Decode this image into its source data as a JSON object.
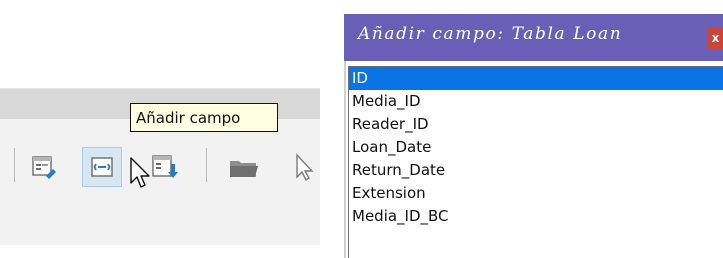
{
  "tooltip": {
    "text": "Añadir campo"
  },
  "toolbar": {
    "buttons": [
      {
        "icon": "form-design-icon"
      },
      {
        "icon": "add-field-icon",
        "active": true
      },
      {
        "icon": "insert-field-icon"
      },
      {
        "icon": "open-folder-icon"
      },
      {
        "icon": "select-pointer-icon"
      }
    ]
  },
  "dialog": {
    "title": "Añadir campo: Tabla Loan",
    "close_label": "x",
    "fields": [
      "ID",
      "Media_ID",
      "Reader_ID",
      "Loan_Date",
      "Return_Date",
      "Extension",
      "Media_ID_BC"
    ],
    "selected_index": 0
  },
  "colors": {
    "title_bar": "#6a5fb7",
    "close_button": "#c9453b",
    "selection": "#0a74e6",
    "tooltip_bg": "#ffffe1",
    "active_button_bg": "#d7e6f3"
  }
}
